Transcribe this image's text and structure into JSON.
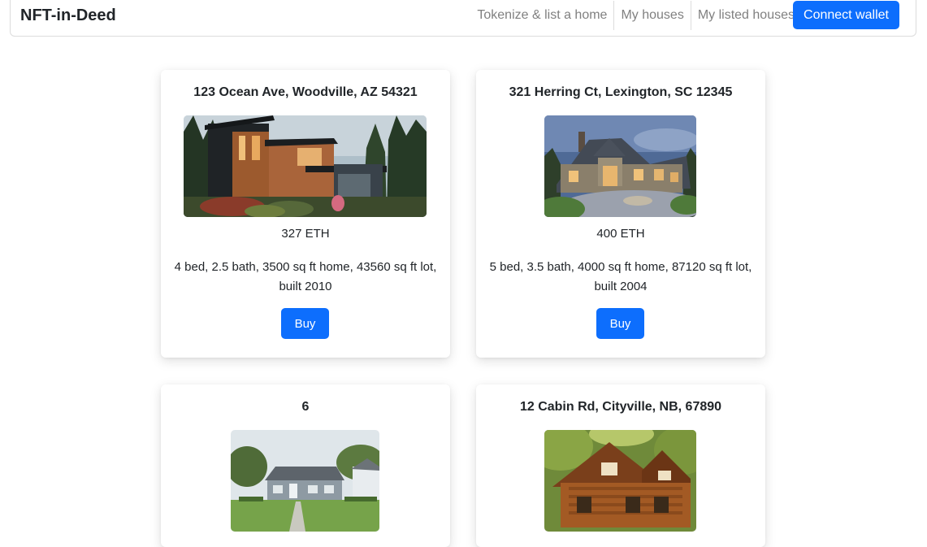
{
  "navbar": {
    "brand": "NFT-in-Deed",
    "links": [
      "Tokenize & list a home",
      "My houses",
      "My listed houses"
    ],
    "connect_label": "Connect wallet"
  },
  "listings": [
    {
      "address": "123 Ocean Ave, Woodville, AZ 54321",
      "price": "327 ETH",
      "description": "4 bed, 2.5 bath, 3500 sq ft home, 43560 sq ft lot, built 2010",
      "buy_label": "Buy",
      "image": "modern-wood-house-photo"
    },
    {
      "address": "321 Herring Ct, Lexington, SC 12345",
      "price": "400 ETH",
      "description": "5 bed, 3.5 bath, 4000 sq ft home, 87120 sq ft lot, built 2004",
      "buy_label": "Buy",
      "image": "stone-manor-house-photo"
    },
    {
      "address": "6",
      "image": "small-gray-house-photo"
    },
    {
      "address": "12 Cabin Rd, Cityville, NB, 67890",
      "image": "log-cabin-photo"
    }
  ]
}
